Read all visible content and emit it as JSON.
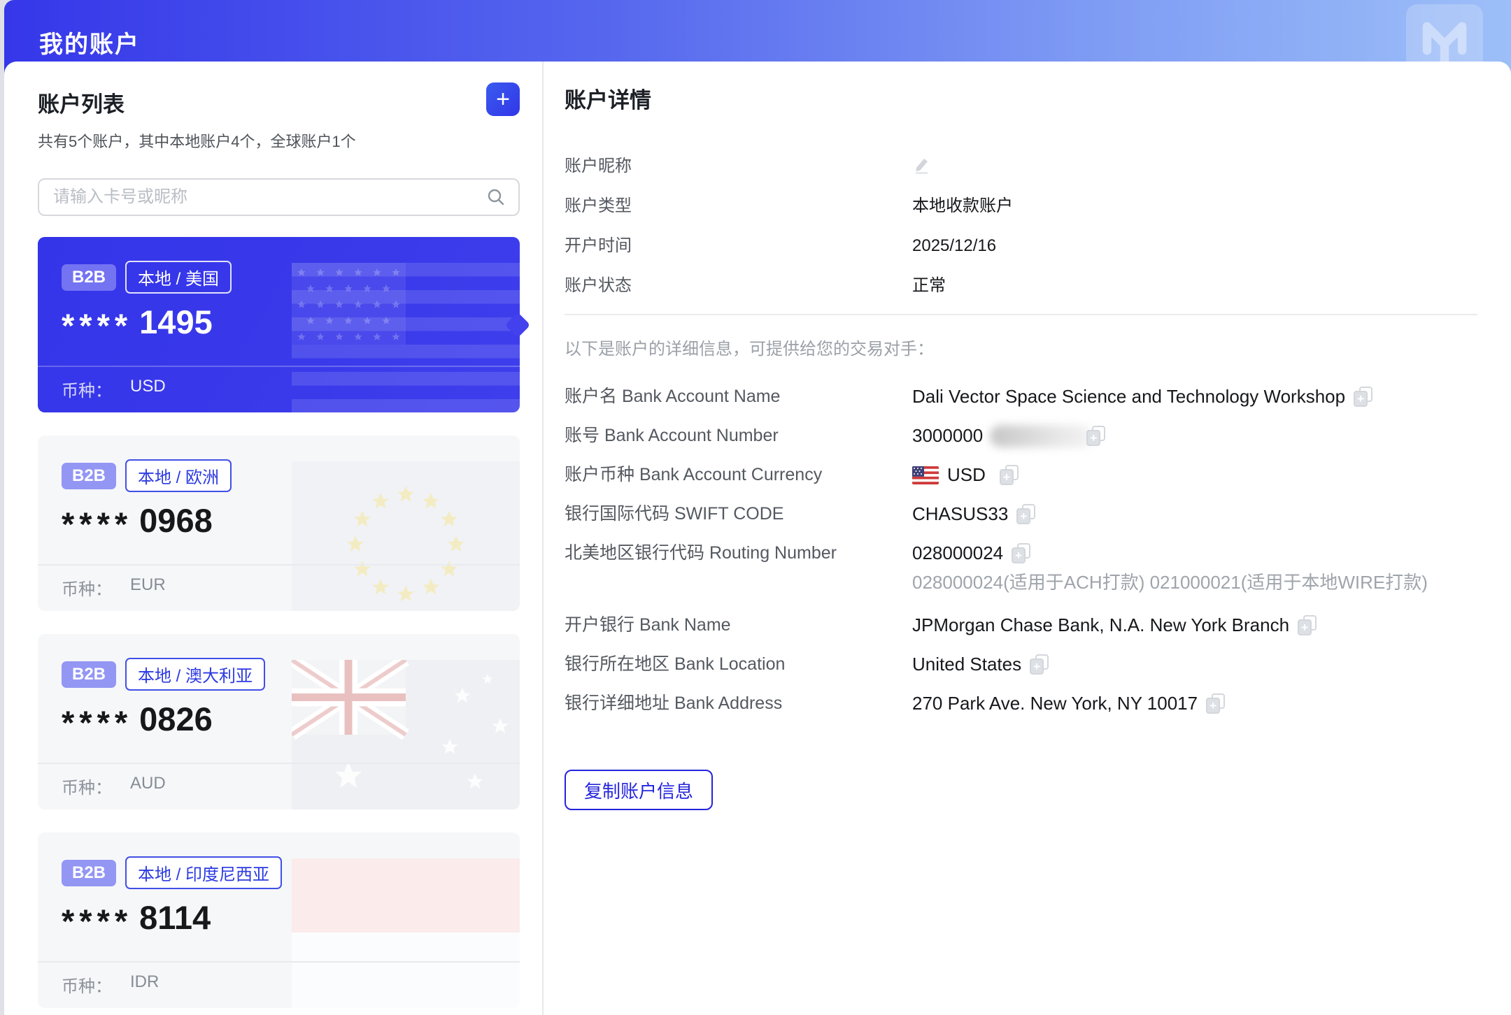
{
  "header": {
    "title": "我的账户"
  },
  "colors": {
    "accent_blue": "#2424dd",
    "selected_card_blue": "#3434e9",
    "header_gradient": [
      "#3537e9",
      "#9dbff8"
    ],
    "badge_lavender": "#9396f3",
    "unselected_card_bg": "#f6f7f9"
  },
  "account_list": {
    "title": "账户列表",
    "add_button_label": "+",
    "summary": "共有5个账户，其中本地账户4个，全球账户1个",
    "search_placeholder": "请输入卡号或昵称",
    "currency_label": "币种：",
    "cards": [
      {
        "type_badge": "B2B",
        "region_badge": "本地 / 美国",
        "masked_prefix": "****",
        "last_digits": "1495",
        "currency": "USD",
        "flag": "us-flag",
        "selected": true
      },
      {
        "type_badge": "B2B",
        "region_badge": "本地 / 欧洲",
        "masked_prefix": "****",
        "last_digits": "0968",
        "currency": "EUR",
        "flag": "eu-flag",
        "selected": false
      },
      {
        "type_badge": "B2B",
        "region_badge": "本地 / 澳大利亚",
        "masked_prefix": "****",
        "last_digits": "0826",
        "currency": "AUD",
        "flag": "australia-flag",
        "selected": false
      },
      {
        "type_badge": "B2B",
        "region_badge": "本地 / 印度尼西亚",
        "masked_prefix": "****",
        "last_digits": "8114",
        "currency": "IDR",
        "flag": "indonesia-flag",
        "selected": false
      }
    ]
  },
  "account_details": {
    "title": "账户详情",
    "info_rows": [
      {
        "label": "账户昵称",
        "value": ""
      },
      {
        "label": "账户类型",
        "value": "本地收款账户"
      },
      {
        "label": "开户时间",
        "value": "2025/12/16"
      },
      {
        "label": "账户状态",
        "value": "正常"
      }
    ],
    "section_hint": "以下是账户的详细信息，可提供给您的交易对手：",
    "bank_rows": [
      {
        "label": "账户名 Bank Account Name",
        "value": "Dali Vector Space Science and Technology Workshop"
      },
      {
        "label": "账号 Bank Account Number",
        "value": "3000000",
        "masked": true
      },
      {
        "label": "账户币种 Bank Account Currency",
        "value": "USD",
        "flag": "us"
      },
      {
        "label": "银行国际代码 SWIFT CODE",
        "value": "CHASUS33"
      },
      {
        "label": "北美地区银行代码 Routing Number",
        "value": "028000024",
        "note": "028000024(适用于ACH打款) 021000021(适用于本地WIRE打款)"
      },
      {
        "label": "开户银行 Bank Name",
        "value": "JPMorgan Chase Bank, N.A. New York Branch"
      },
      {
        "label": "银行所在地区 Bank Location",
        "value": "United States"
      },
      {
        "label": "银行详细地址 Bank Address",
        "value": "270 Park Ave. New York, NY 10017"
      }
    ],
    "copy_button_label": "复制账户信息"
  }
}
